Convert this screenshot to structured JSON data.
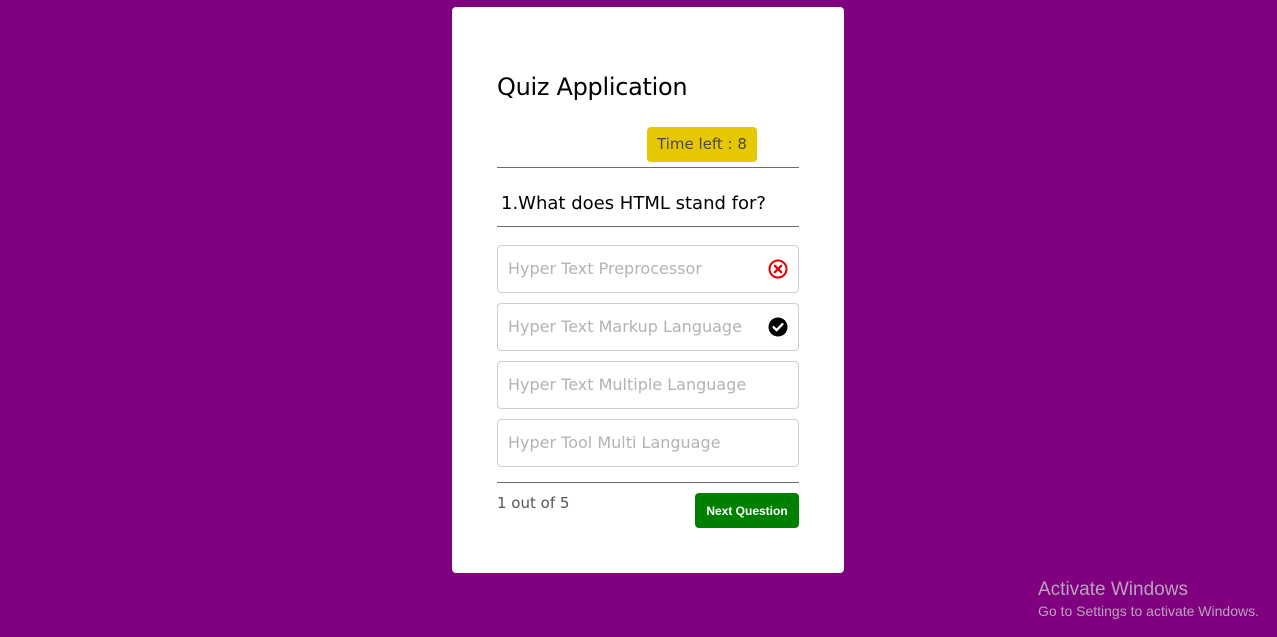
{
  "quiz": {
    "title": "Quiz Application",
    "timer_text": "Time left : 8",
    "question": "1.What does HTML stand for?",
    "options": [
      {
        "label": "Hyper Text Preprocessor",
        "state": "incorrect",
        "icon": "x-circle-icon",
        "icon_color": "#e00000"
      },
      {
        "label": "Hyper Text Markup Language",
        "state": "correct",
        "icon": "check-circle-icon",
        "icon_color": "#000000"
      },
      {
        "label": "Hyper Text Multiple Language",
        "state": "none"
      },
      {
        "label": "Hyper Tool Multi Language",
        "state": "none"
      }
    ],
    "progress_text": "1 out of 5",
    "next_label": "Next Question"
  },
  "colors": {
    "background": "#800080",
    "card": "#ffffff",
    "timer": "#e6c800",
    "next_button": "#008000"
  },
  "watermark": {
    "title": "Activate Windows",
    "subtitle": "Go to Settings to activate Windows."
  }
}
